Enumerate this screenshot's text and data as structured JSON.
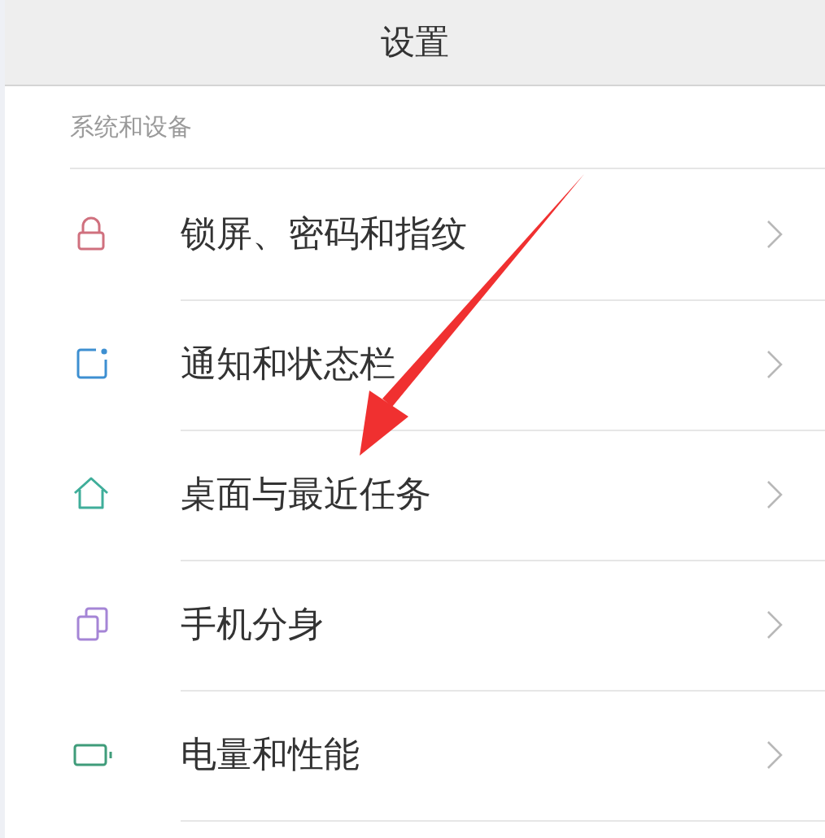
{
  "header": {
    "title": "设置"
  },
  "section": {
    "title": "系统和设备"
  },
  "items": [
    {
      "label": "锁屏、密码和指纹",
      "kind": "lock",
      "color": "#d0707e"
    },
    {
      "label": "通知和状态栏",
      "kind": "notification",
      "color": "#3d8fd1"
    },
    {
      "label": "桌面与最近任务",
      "kind": "home",
      "color": "#3fae9a"
    },
    {
      "label": "手机分身",
      "kind": "clone",
      "color": "#a585d6"
    },
    {
      "label": "电量和性能",
      "kind": "battery",
      "color": "#3f9c7a"
    }
  ]
}
